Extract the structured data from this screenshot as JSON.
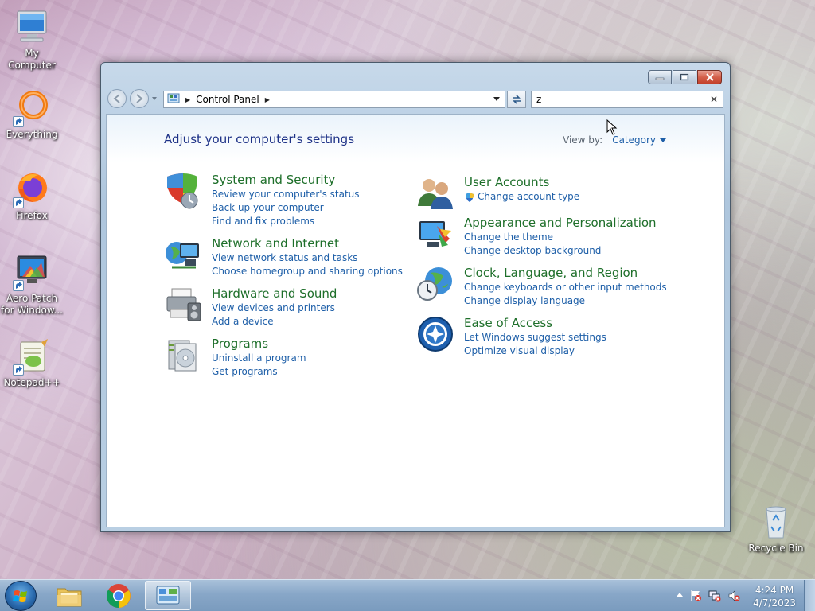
{
  "desktop": {
    "icons": [
      {
        "label": "My Computer"
      },
      {
        "label": "Everything"
      },
      {
        "label": "Firefox"
      },
      {
        "label": "Aero Patch for Window..."
      },
      {
        "label": "Notepad++"
      },
      {
        "label": "Recycle Bin"
      }
    ]
  },
  "window": {
    "breadcrumb": {
      "location": "Control Panel"
    },
    "search": {
      "value": "z"
    },
    "heading": "Adjust your computer's settings",
    "view_by": {
      "label": "View by:",
      "value": "Category"
    },
    "categories_left": [
      {
        "title": "System and Security",
        "links": [
          "Review your computer's status",
          "Back up your computer",
          "Find and fix problems"
        ]
      },
      {
        "title": "Network and Internet",
        "links": [
          "View network status and tasks",
          "Choose homegroup and sharing options"
        ]
      },
      {
        "title": "Hardware and Sound",
        "links": [
          "View devices and printers",
          "Add a device"
        ]
      },
      {
        "title": "Programs",
        "links": [
          "Uninstall a program",
          "Get programs"
        ]
      }
    ],
    "categories_right": [
      {
        "title": "User Accounts",
        "links": [
          "Change account type"
        ]
      },
      {
        "title": "Appearance and Personalization",
        "links": [
          "Change the theme",
          "Change desktop background"
        ]
      },
      {
        "title": "Clock, Language, and Region",
        "links": [
          "Change keyboards or other input methods",
          "Change display language"
        ]
      },
      {
        "title": "Ease of Access",
        "links": [
          "Let Windows suggest settings",
          "Optimize visual display"
        ]
      }
    ]
  },
  "taskbar": {
    "items": [
      "windows-explorer-icon",
      "chrome-icon",
      "control-panel-icon"
    ],
    "clock": {
      "time": "4:24 PM",
      "date": "4/7/2023"
    }
  },
  "colors": {
    "category_title": "#1e6f2a",
    "link": "#1e5fa8",
    "heading": "#1e3287"
  }
}
